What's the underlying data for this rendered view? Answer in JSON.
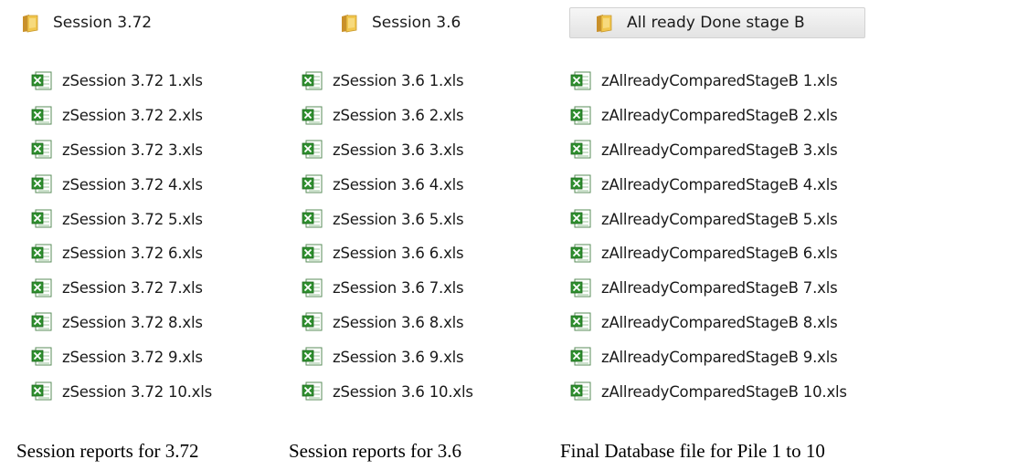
{
  "folders": [
    {
      "name": "Session 3.72",
      "selected": false
    },
    {
      "name": "Session 3.6",
      "selected": false
    },
    {
      "name": "All ready Done stage B",
      "selected": true
    }
  ],
  "files": {
    "col1": [
      "zSession 3.72 1.xls",
      "zSession 3.72 2.xls",
      "zSession 3.72 3.xls",
      "zSession 3.72 4.xls",
      "zSession 3.72 5.xls",
      "zSession 3.72 6.xls",
      "zSession 3.72 7.xls",
      "zSession 3.72 8.xls",
      "zSession 3.72 9.xls",
      "zSession 3.72 10.xls"
    ],
    "col2": [
      "zSession 3.6 1.xls",
      "zSession 3.6 2.xls",
      "zSession 3.6 3.xls",
      "zSession 3.6 4.xls",
      "zSession 3.6 5.xls",
      "zSession 3.6 6.xls",
      "zSession 3.6 7.xls",
      "zSession 3.6 8.xls",
      "zSession 3.6 9.xls",
      "zSession 3.6 10.xls"
    ],
    "col3": [
      "zAllreadyComparedStageB 1.xls",
      "zAllreadyComparedStageB 2.xls",
      "zAllreadyComparedStageB 3.xls",
      "zAllreadyComparedStageB 4.xls",
      "zAllreadyComparedStageB 5.xls",
      "zAllreadyComparedStageB 6.xls",
      "zAllreadyComparedStageB 7.xls",
      "zAllreadyComparedStageB 8.xls",
      "zAllreadyComparedStageB 9.xls",
      "zAllreadyComparedStageB 10.xls"
    ]
  },
  "captions": [
    "Session reports for 3.72",
    "Session reports for 3.6",
    "Final Database file for Pile 1 to 10"
  ],
  "icons": {
    "folder": "folder-icon",
    "file": "excel-file-icon"
  },
  "colors": {
    "folder_yellow": "#e8b53c",
    "excel_green": "#2f8f2f",
    "selection_bg": "#e9e9e9"
  }
}
